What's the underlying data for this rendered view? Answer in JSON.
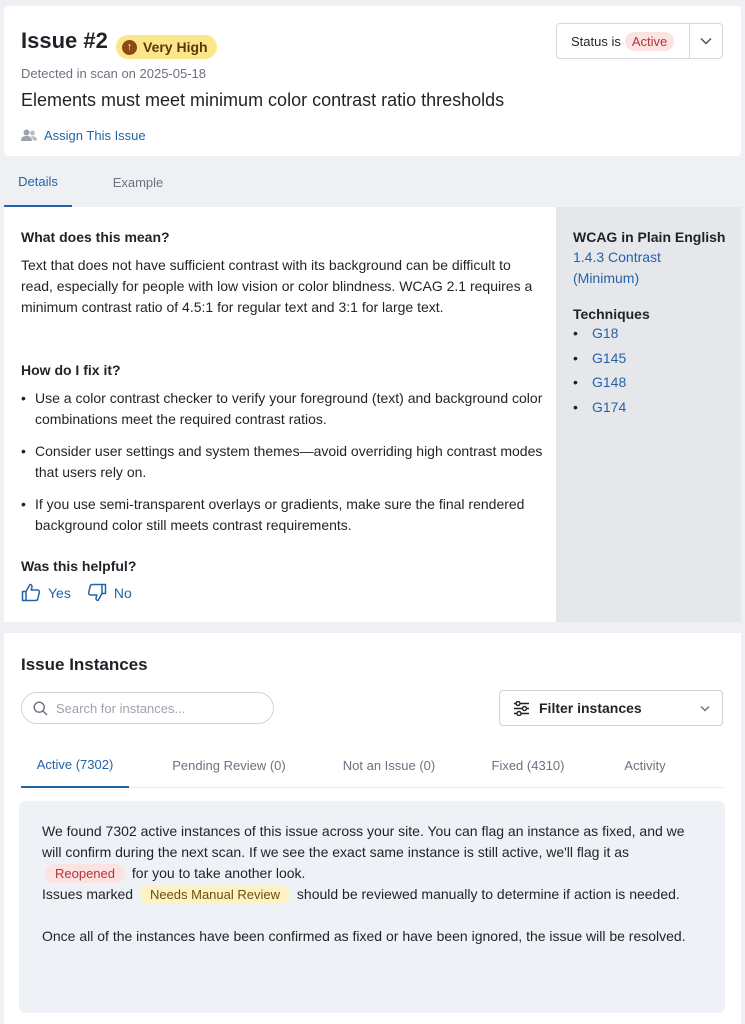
{
  "header": {
    "issue_title": "Issue #2",
    "severity": "Very High",
    "detected": "Detected in scan on 2025-05-18",
    "description": "Elements must meet minimum color contrast ratio thresholds",
    "assign_label": "Assign This Issue",
    "status_prefix": "Status is",
    "status_value": "Active"
  },
  "detail_tabs": {
    "details": "Details",
    "example": "Example"
  },
  "details": {
    "q1": "What does this mean?",
    "a1": "Text that does not have sufficient contrast with its background can be difficult to read, especially for people with low vision or color blindness. WCAG 2.1 requires a minimum contrast ratio of 4.5:1 for regular text and 3:1 for large text.",
    "q2": "How do I fix it?",
    "fixes": [
      "Use a color contrast checker to verify your foreground (text) and background color combinations meet the required contrast ratios.",
      "Consider user settings and system themes—avoid overriding high contrast modes that users rely on.",
      "If you use semi-transparent overlays or gradients, make sure the final rendered background color still meets contrast requirements."
    ],
    "q3": "Was this helpful?",
    "yes": "Yes",
    "no": "No"
  },
  "sidebar": {
    "wcag_title": "WCAG in Plain English",
    "wcag_link": "1.4.3 Contrast (Minimum)",
    "techniques_title": "Techniques",
    "techniques": [
      "G18",
      "G145",
      "G148",
      "G174"
    ]
  },
  "instances": {
    "title": "Issue Instances",
    "search_placeholder": "Search for instances...",
    "filter_label": "Filter instances",
    "tabs": [
      "Active (7302)",
      "Pending Review (0)",
      "Not an Issue (0)",
      "Fixed (4310)",
      "Activity"
    ],
    "info_1_pre": "We found 7302 active instances of this issue across your site. You can flag an instance as fixed, and we will confirm during the next scan. If we see the exact same instance is still active, we'll flag it as",
    "info_1_pill": "Reopened",
    "info_1_post": "for you to take another look.",
    "info_2_pre": "Issues marked",
    "info_2_pill": "Needs Manual Review",
    "info_2_post": "should be reviewed manually to determine if action is needed.",
    "info_3": "Once all of the instances have been confirmed as fixed or have been ignored, the issue will be resolved."
  },
  "colors": {
    "accent": "#2563a8",
    "severity_bg": "#fde68a",
    "status_bg": "#fde2e2"
  }
}
